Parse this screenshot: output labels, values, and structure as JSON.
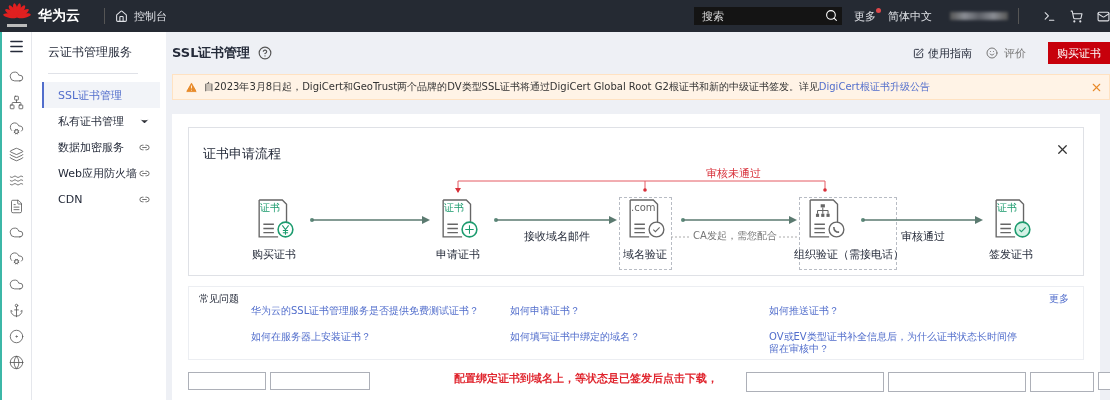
{
  "topbar": {
    "brand": "华为云",
    "console": "控制台",
    "search": {
      "placeholder": "搜索"
    },
    "more": {
      "label": "更多",
      "notification": true
    },
    "language": "简体中文"
  },
  "rail": {
    "items": [
      {
        "kind": "cloud"
      },
      {
        "kind": "cluster"
      },
      {
        "kind": "cloud-gear"
      },
      {
        "kind": "cloud-stack"
      },
      {
        "kind": "bridge"
      },
      {
        "kind": "document"
      },
      {
        "kind": "cloud"
      },
      {
        "kind": "cloud-gear"
      },
      {
        "kind": "cloud"
      },
      {
        "kind": "anchor"
      },
      {
        "kind": "ip"
      },
      {
        "kind": "globe"
      }
    ]
  },
  "sidebar": {
    "title": "云证书管理服务",
    "items": [
      {
        "label": "SSL证书管理",
        "kind": "plain",
        "selected": true
      },
      {
        "label": "私有证书管理",
        "kind": "expandable",
        "selected": false
      },
      {
        "label": "数据加密服务",
        "kind": "external",
        "selected": false
      },
      {
        "label": "Web应用防火墙",
        "kind": "external",
        "selected": false
      },
      {
        "label": "CDN",
        "kind": "external",
        "selected": false
      }
    ]
  },
  "header": {
    "title": "SSL证书管理",
    "guide": "使用指南",
    "rate": "评价",
    "buy_button": "购买证书"
  },
  "notice": {
    "text": "自2023年3月8日起，DigiCert和GeoTrust两个品牌的DV类型SSL证书将通过DigiCert Global Root G2根证书和新的中级证书签发。详见",
    "link": "DigiCert根证书升级公告"
  },
  "flow": {
    "title": "证书申请流程",
    "rejected_label": "审核未通过",
    "ca_note": "CA发起，需您配合",
    "steps": [
      {
        "label": "购买证书",
        "caption": "证书",
        "kind": "buy",
        "dashed": false
      },
      {
        "label": "申请证书",
        "caption": "证书",
        "kind": "apply",
        "dashed": false,
        "next_label": "接收域名邮件"
      },
      {
        "label": "域名验证",
        "caption": ".com",
        "kind": "domain",
        "dashed": true
      },
      {
        "label": "组织验证（需接电话）",
        "kind": "organization",
        "dashed": true,
        "next_label": "审核通过"
      },
      {
        "label": "签发证书",
        "caption": "证书",
        "kind": "issue",
        "dashed": false
      }
    ]
  },
  "faq": {
    "title": "常见问题",
    "more": "更多",
    "questions": [
      "华为云的SSL证书管理服务是否提供免费测试证书？",
      "如何申请证书？",
      "如何推送证书？",
      "如何在服务器上安装证书？",
      "如何填写证书中绑定的域名？",
      "OV或EV类型证书补全信息后，为什么证书状态长时间停留在审核中？"
    ]
  },
  "toolbar": {
    "note": "配置绑定证书到域名上，等状态是已签发后点击下载，"
  }
}
